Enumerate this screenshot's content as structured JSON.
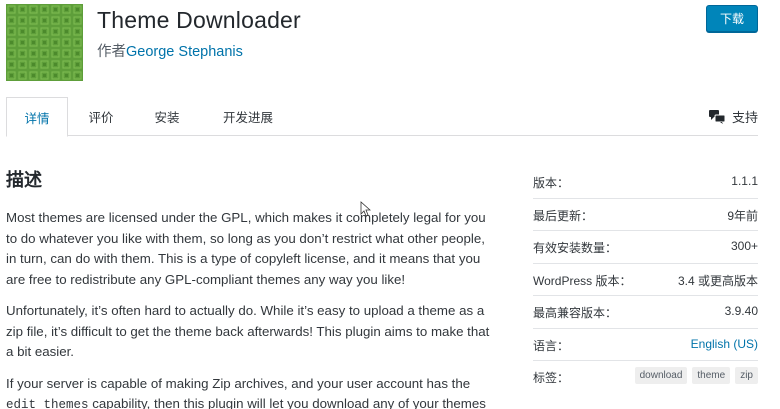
{
  "plugin": {
    "title": "Theme Downloader",
    "author_prefix": "作者",
    "author_name": "George Stephanis",
    "download_label": "下载",
    "icon_color": "#5e9e3a"
  },
  "tabs": [
    {
      "label": "详情",
      "active": true
    },
    {
      "label": "评价",
      "active": false
    },
    {
      "label": "安装",
      "active": false
    },
    {
      "label": "开发进展",
      "active": false
    }
  ],
  "support_label": "支持",
  "description": {
    "heading": "描述",
    "p1": "Most themes are licensed under the GPL, which makes it completely legal for you to do whatever you like with them, so long as you don’t restrict what other people, in turn, can do with them. This is a type of copyleft license, and it means that you are free to redistribute any GPL-compliant themes any way you like!",
    "p2": "Unfortunately, it’s often hard to actually do. While it’s easy to upload a theme as a zip file, it’s difficult to get the theme back afterwards! This plugin aims to make that a bit easier.",
    "p3_before": "If your server is capable of making Zip archives, and your user account has the ",
    "p3_code": "edit_themes",
    "p3_after": " capability, then this plugin will let you download any of your themes"
  },
  "meta": {
    "version_label": "版本：",
    "version_value": "1.1.1",
    "updated_label": "最后更新：",
    "updated_value": "9年前",
    "installs_label": "有效安装数量：",
    "installs_value": "300+",
    "wp_label": "WordPress 版本：",
    "wp_value": "3.4 或更高版本",
    "tested_label": "最高兼容版本：",
    "tested_value": "3.9.40",
    "lang_label": "语言：",
    "lang_value": "English (US)",
    "tags_label": "标签：",
    "tags": [
      "download",
      "theme",
      "zip"
    ]
  },
  "colors": {
    "accent": "#0073aa",
    "button": "#0085ba"
  }
}
